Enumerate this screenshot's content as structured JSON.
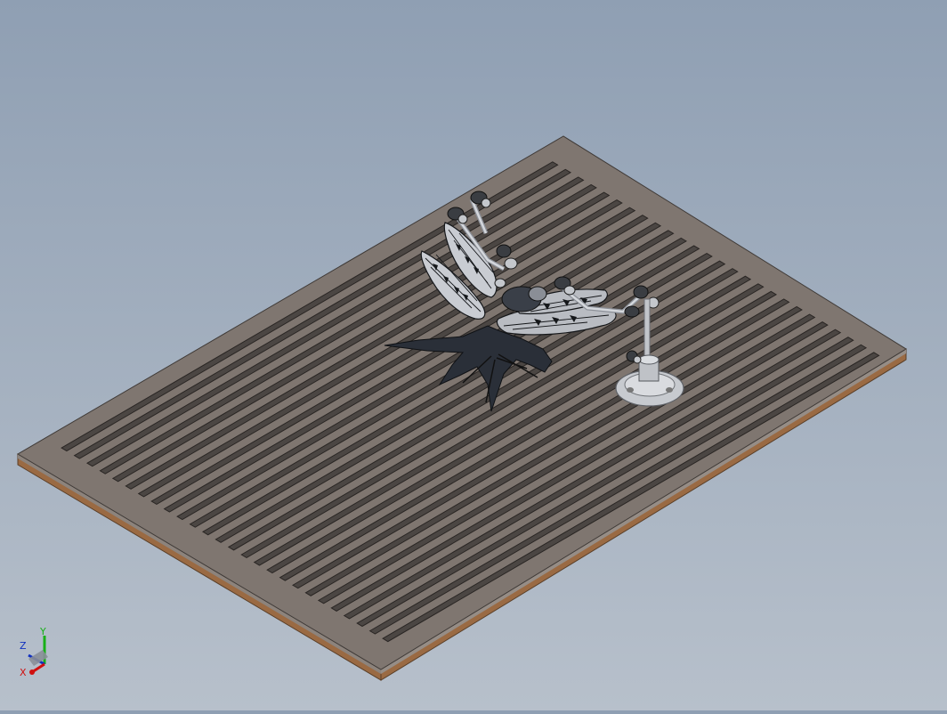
{
  "viewport": {
    "background_top": "#8f9fb3",
    "background_bottom": "#b7c0cb"
  },
  "model": {
    "plate_face_color": "#7f7670",
    "plate_edge_color": "#6f6660",
    "plate_bottom_color": "#9a6a43",
    "slot_color": "#4b4643",
    "slot_count": 26,
    "part_color": "#1e2126",
    "fixture_color": "#b8bcc2"
  },
  "triad": {
    "x_label": "X",
    "y_label": "Y",
    "z_label": "Z",
    "x_color": "#d01010",
    "y_color": "#18b018",
    "z_color": "#1030c0"
  }
}
